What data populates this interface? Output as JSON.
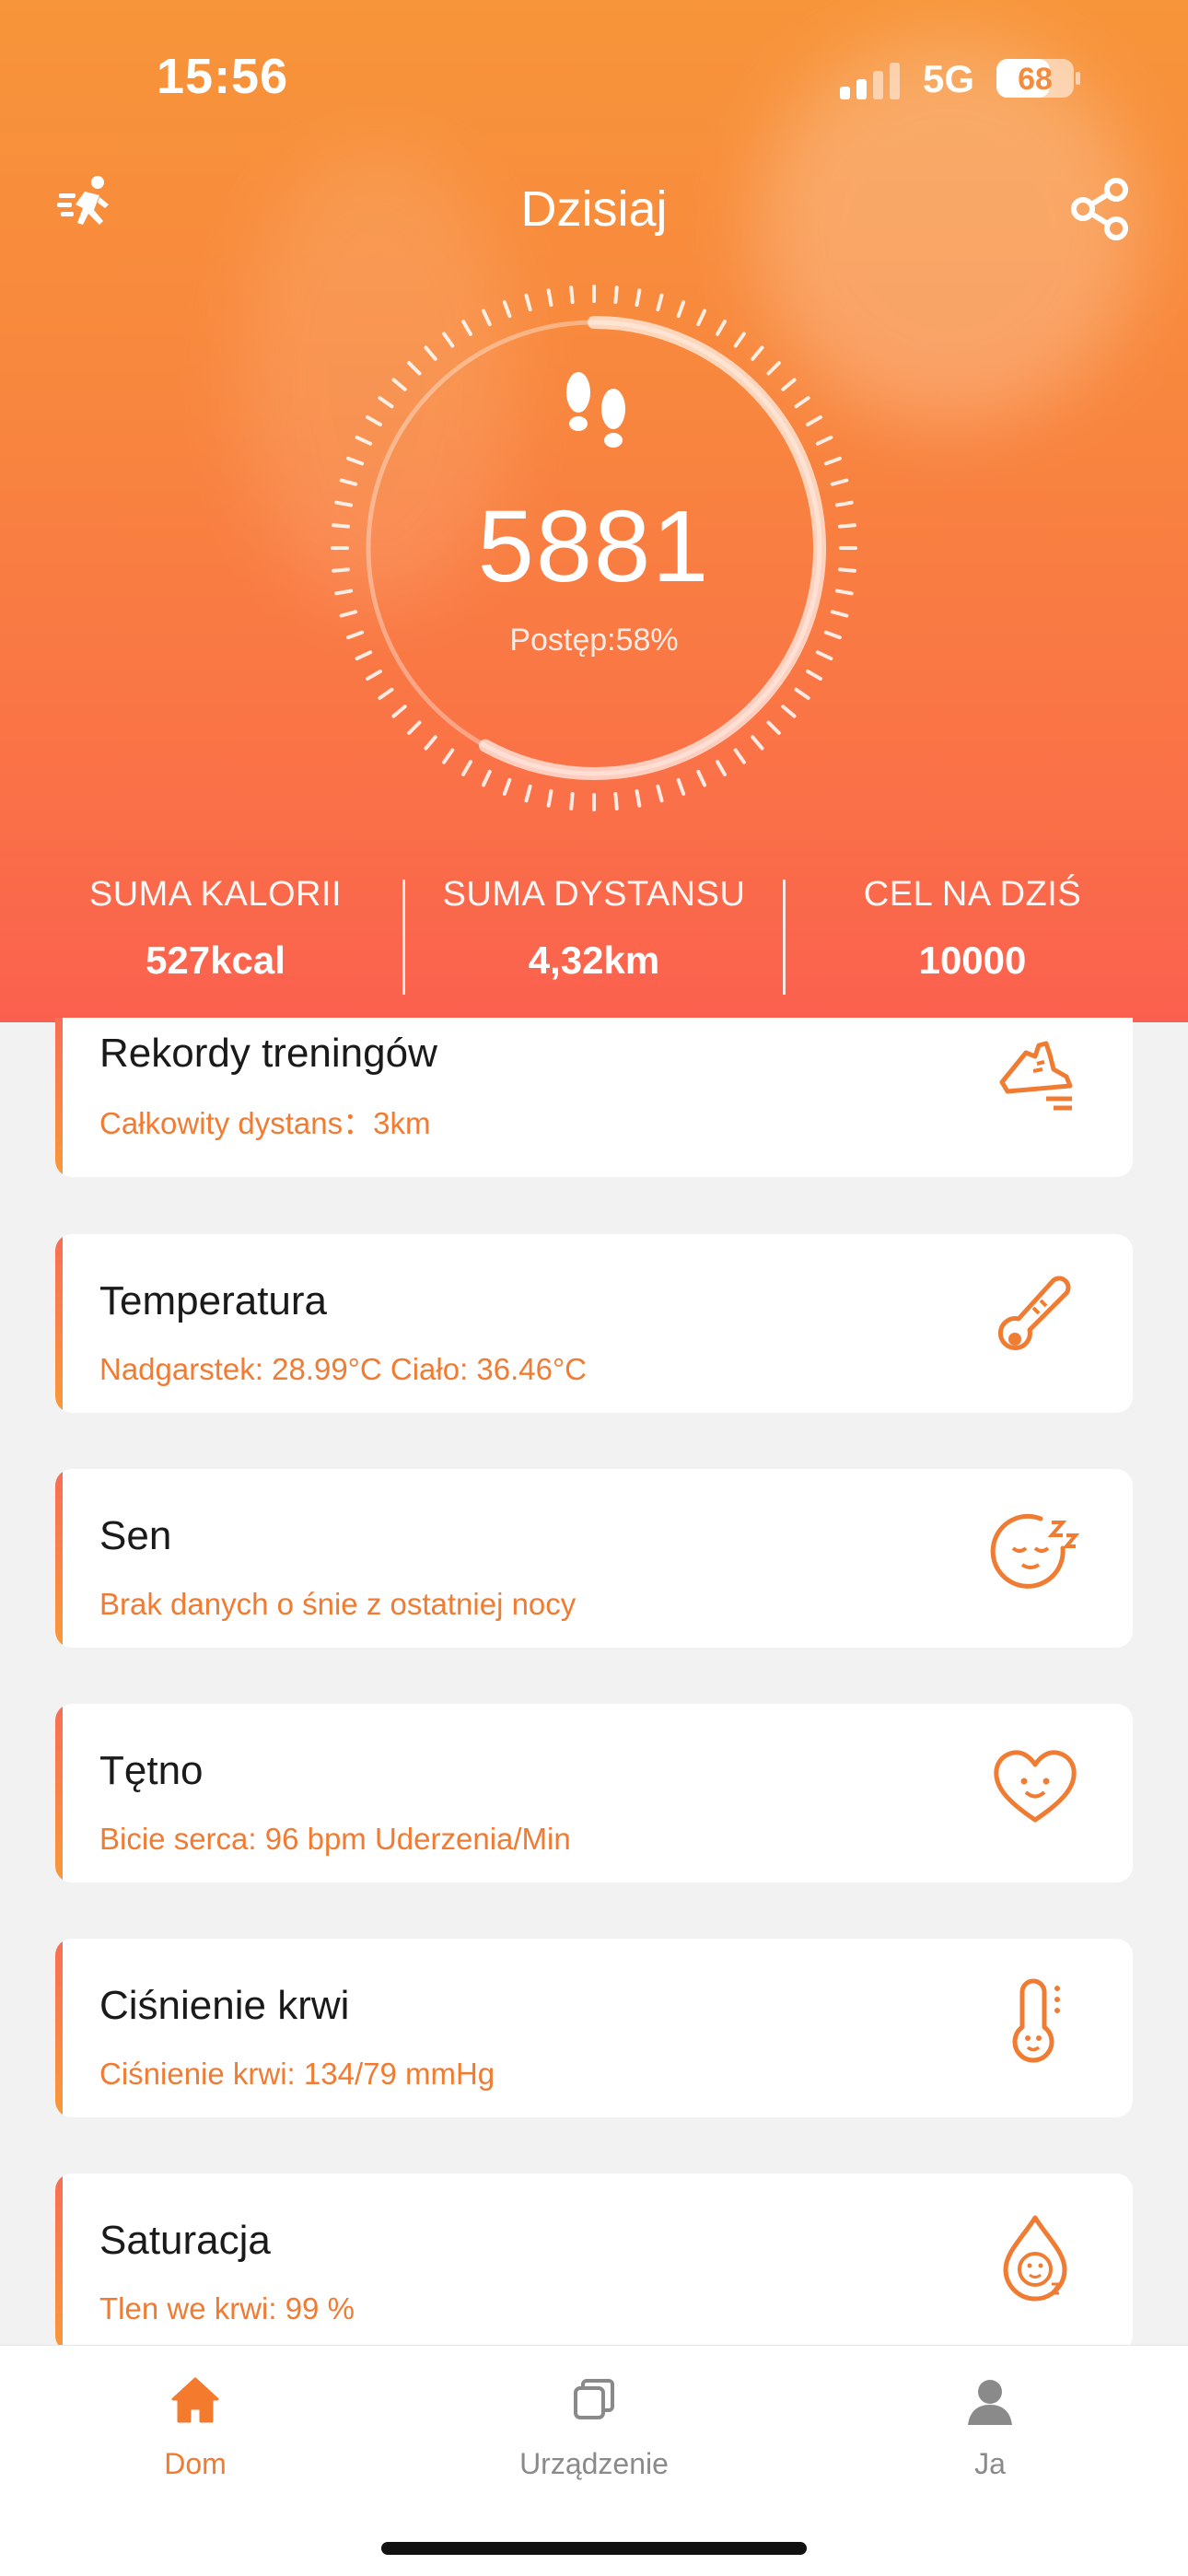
{
  "status": {
    "time": "15:56",
    "network": "5G",
    "battery": "68"
  },
  "header": {
    "title": "Dzisiaj"
  },
  "ring": {
    "steps": "5881",
    "progress_label": "Postęp:58%",
    "progress_fraction": 0.58
  },
  "stats": [
    {
      "label": "SUMA KALORII",
      "value": "527kcal"
    },
    {
      "label": "SUMA DYSTANSU",
      "value": "4,32km"
    },
    {
      "label": "CEL NA DZIŚ",
      "value": "10000"
    }
  ],
  "cards": [
    {
      "title": "Rekordy treningów",
      "subtitle": "Całkowity dystans：3km",
      "icon": "running-shoe-icon"
    },
    {
      "title": "Temperatura",
      "subtitle": "Nadgarstek: 28.99°C  Ciało: 36.46°C",
      "icon": "thermometer-icon"
    },
    {
      "title": "Sen",
      "subtitle": "Brak danych o śnie z ostatniej nocy",
      "icon": "sleep-face-icon"
    },
    {
      "title": "Tętno",
      "subtitle": "Bicie serca: 96 bpm Uderzenia/Min",
      "icon": "heart-face-icon"
    },
    {
      "title": "Ciśnienie krwi",
      "subtitle": "Ciśnienie krwi: 134/79 mmHg",
      "icon": "blood-pressure-icon"
    },
    {
      "title": "Saturacja",
      "subtitle": "Tlen we krwi: 99 %",
      "icon": "oxygen-drop-icon"
    }
  ],
  "tabs": [
    {
      "label": "Dom",
      "icon": "home-icon",
      "active": true
    },
    {
      "label": "Urządzenie",
      "icon": "device-icon",
      "active": false
    },
    {
      "label": "Ja",
      "icon": "person-icon",
      "active": false
    }
  ],
  "colors": {
    "accent": "#f47a2e",
    "hero_top": "#f7953a",
    "hero_bottom": "#fb604f"
  }
}
